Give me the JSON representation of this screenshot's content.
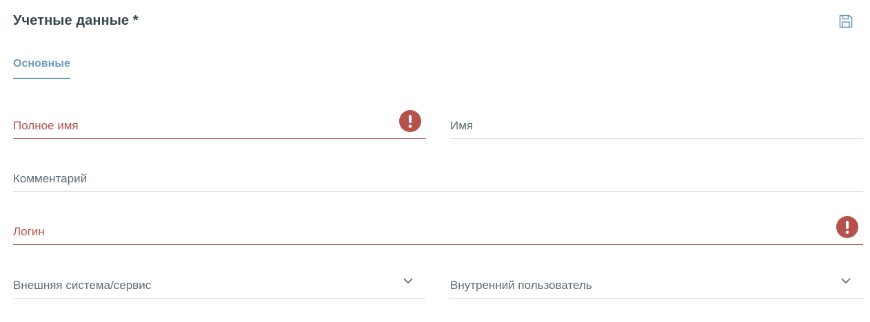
{
  "header": {
    "title": "Учетные данные *",
    "save_icon": "save-icon"
  },
  "tabs": [
    {
      "label": "Основные",
      "active": true
    }
  ],
  "fields": {
    "full_name": {
      "label": "Полное имя",
      "value": "",
      "error": true
    },
    "first_name": {
      "label": "Имя",
      "value": ""
    },
    "comment": {
      "label": "Комментарий",
      "value": ""
    },
    "login": {
      "label": "Логин",
      "value": "",
      "error": true
    },
    "external_system": {
      "label": "Внешняя система/сервис",
      "value": ""
    },
    "internal_user": {
      "label": "Внутренний пользователь",
      "value": ""
    }
  },
  "colors": {
    "accent": "#6b9cbd",
    "error": "#b5524b",
    "text": "#5f6b72",
    "title": "#37474f",
    "divider": "#d9dde0"
  }
}
